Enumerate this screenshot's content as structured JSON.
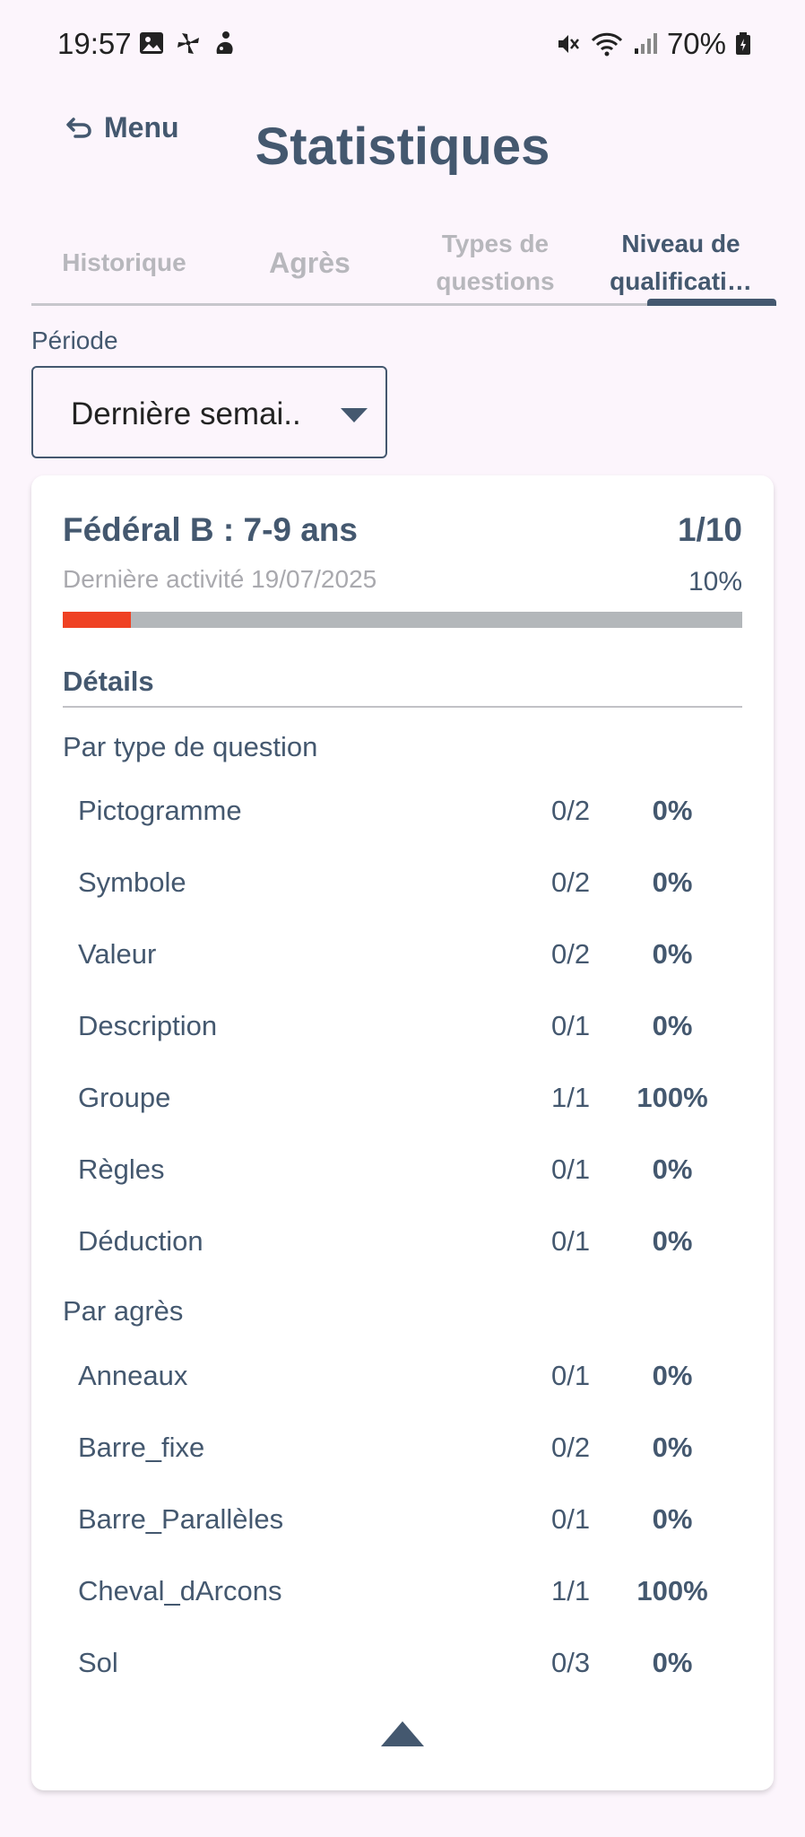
{
  "status_bar": {
    "time": "19:57",
    "battery": "70%",
    "left_icons": [
      "image-icon",
      "pinwheel-icon",
      "figure-icon"
    ],
    "right_icons": [
      "mute-icon",
      "wifi-icon",
      "signal-icon",
      "battery-icon"
    ]
  },
  "header": {
    "menu_label": "Menu",
    "title": "Statistiques"
  },
  "tabs": [
    {
      "label": "Historique",
      "active": false
    },
    {
      "label": "Agrès",
      "active": false
    },
    {
      "label_line1": "Types de",
      "label_line2": "questions",
      "active": false
    },
    {
      "label_line1": "Niveau de",
      "label_line2": "qualificati…",
      "active": true
    }
  ],
  "period": {
    "label": "Période",
    "value": "Dernière semai.."
  },
  "level_card": {
    "title": "Fédéral B : 7-9 ans",
    "score": "1/10",
    "last_activity": "Dernière activité 19/07/2025",
    "percent_label": "10%",
    "progress_fraction": 0.1,
    "details_label": "Détails",
    "by_type_label": "Par type de question",
    "by_type": [
      {
        "name": "Pictogramme",
        "frac": "0/2",
        "pct": "0%"
      },
      {
        "name": "Symbole",
        "frac": "0/2",
        "pct": "0%"
      },
      {
        "name": "Valeur",
        "frac": "0/2",
        "pct": "0%"
      },
      {
        "name": "Description",
        "frac": "0/1",
        "pct": "0%"
      },
      {
        "name": "Groupe",
        "frac": "1/1",
        "pct": "100%"
      },
      {
        "name": "Règles",
        "frac": "0/1",
        "pct": "0%"
      },
      {
        "name": "Déduction",
        "frac": "0/1",
        "pct": "0%"
      }
    ],
    "by_apparatus_label": "Par agrès",
    "by_apparatus": [
      {
        "name": "Anneaux",
        "frac": "0/1",
        "pct": "0%"
      },
      {
        "name": "Barre_fixe",
        "frac": "0/2",
        "pct": "0%"
      },
      {
        "name": "Barre_Parallèles",
        "frac": "0/1",
        "pct": "0%"
      },
      {
        "name": "Cheval_dArcons",
        "frac": "1/1",
        "pct": "100%"
      },
      {
        "name": "Sol",
        "frac": "0/3",
        "pct": "0%"
      }
    ]
  },
  "colors": {
    "background": "#fcf5fc",
    "text": "#44586f",
    "progress_fill": "#ef4123",
    "progress_track": "#b3b7ba"
  }
}
